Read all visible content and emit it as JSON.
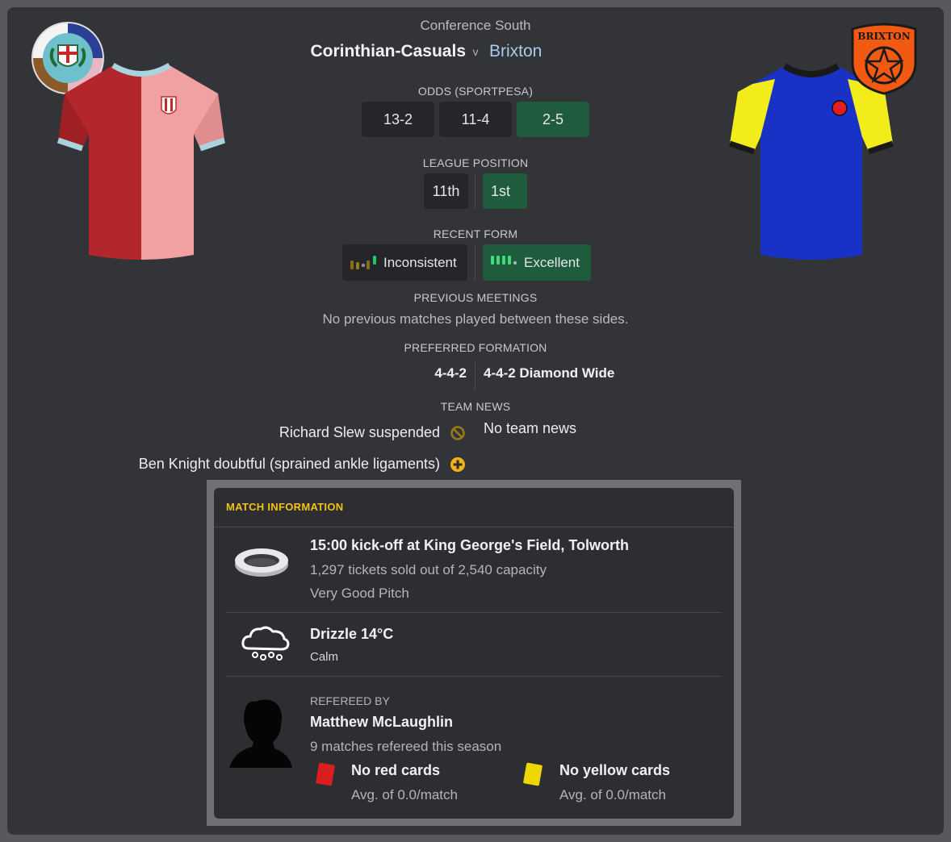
{
  "competition": "Conference South",
  "home_team": "Corinthian-Casuals",
  "vs": "v",
  "away_team": "Brixton",
  "away_badge_text": "BRIXTON",
  "odds": {
    "label": "ODDS (SPORTPESA)",
    "home": "13-2",
    "draw": "11-4",
    "away": "2-5"
  },
  "league_position": {
    "label": "LEAGUE POSITION",
    "home": "11th",
    "away": "1st"
  },
  "recent_form": {
    "label": "RECENT FORM",
    "home": "Inconsistent",
    "away": "Excellent"
  },
  "previous_meetings": {
    "label": "PREVIOUS MEETINGS",
    "text": "No previous matches played between these sides."
  },
  "preferred_formation": {
    "label": "PREFERRED FORMATION",
    "home": "4-4-2",
    "away": "4-4-2 Diamond Wide"
  },
  "team_news": {
    "label": "TEAM NEWS",
    "home": [
      {
        "text": "Richard Slew suspended",
        "icon": "suspended-icon"
      },
      {
        "text": "Ben Knight doubtful (sprained ankle ligaments)",
        "icon": "injury-icon"
      }
    ],
    "away": "No team news"
  },
  "match_info": {
    "title": "MATCH INFORMATION",
    "venue": {
      "headline": "15:00 kick-off at King George's Field, Tolworth",
      "tickets": "1,297 tickets sold out of 2,540 capacity",
      "pitch": "Very Good Pitch",
      "icon": "stadium-icon"
    },
    "weather": {
      "headline": "Drizzle 14°C",
      "wind": "Calm",
      "icon": "drizzle-cloud-icon"
    },
    "referee": {
      "label": "REFEREED BY",
      "name": "Matthew McLaughlin",
      "matches": "9 matches refereed this season",
      "red_cards": "No red cards",
      "red_avg": "Avg. of 0.0/match",
      "yellow_cards": "No yellow cards",
      "yellow_avg": "Avg. of 0.0/match"
    }
  },
  "colors": {
    "panel": "#333438",
    "accent_yellow": "#f2c11a",
    "good_green": "#1f5c3d",
    "away_name": "#a9cbee"
  }
}
